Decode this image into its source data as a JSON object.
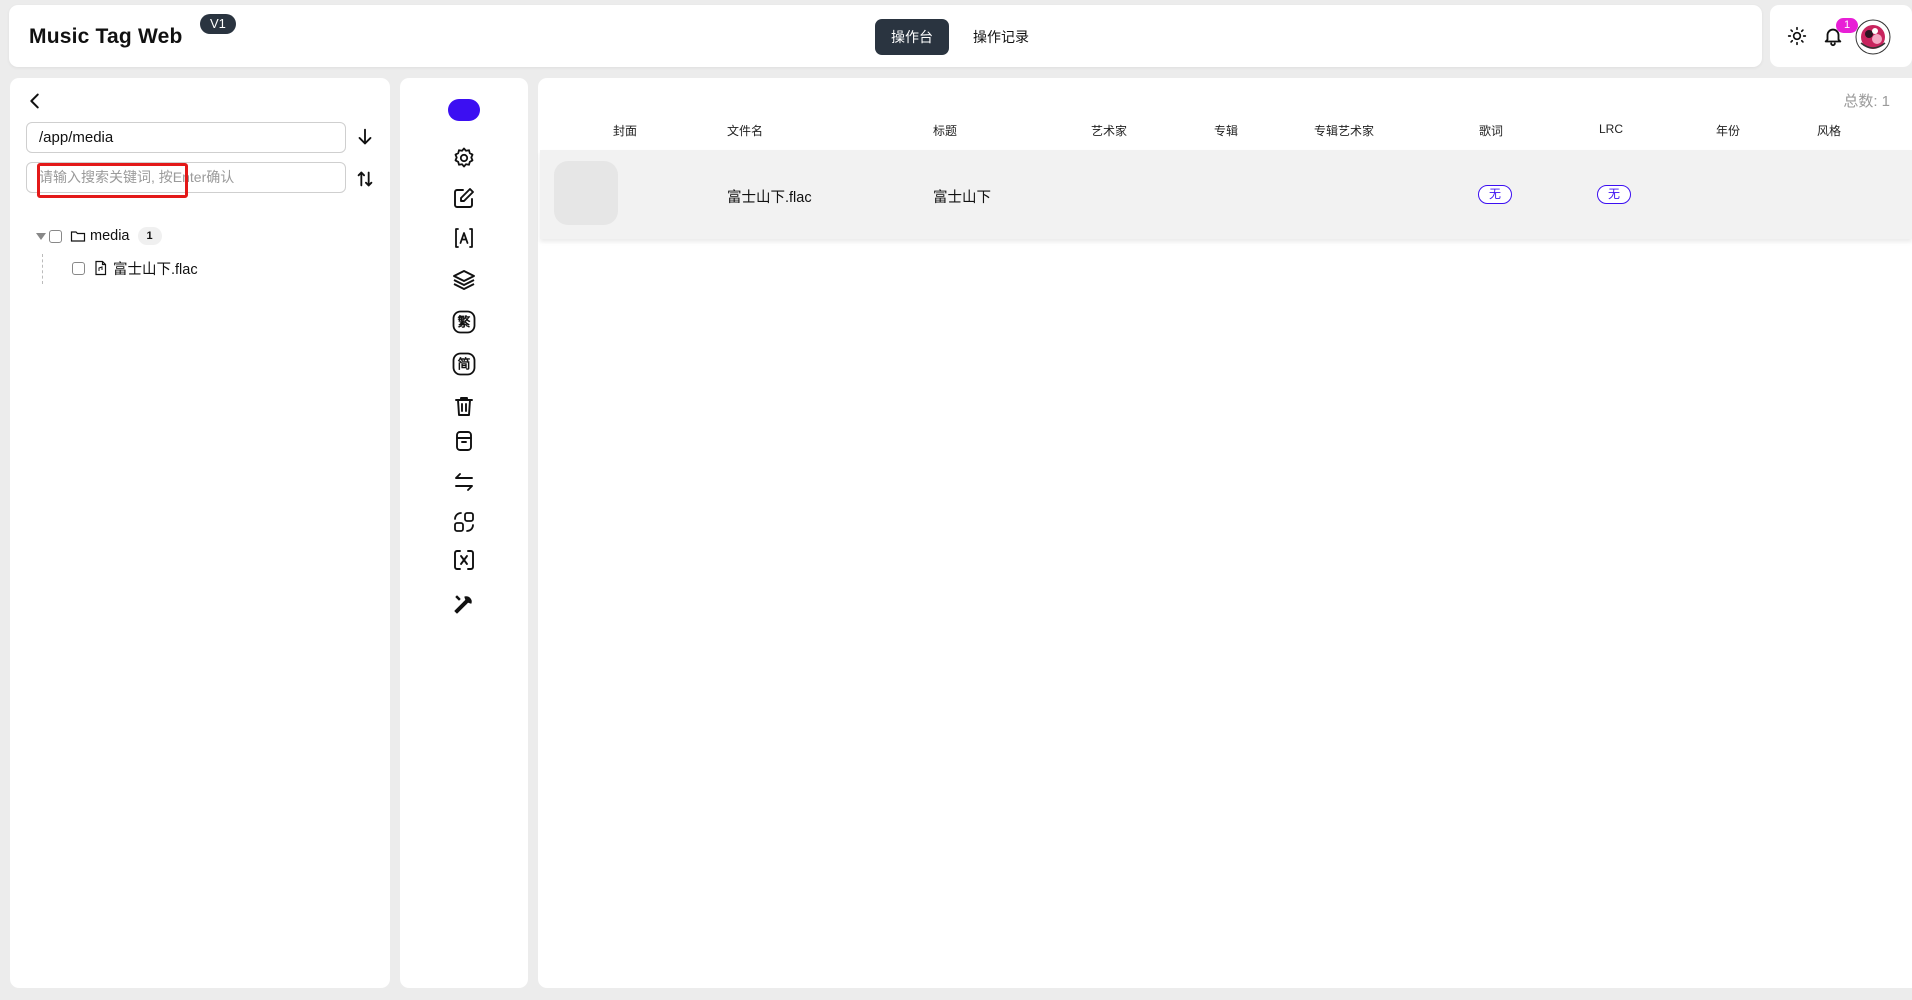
{
  "header": {
    "brand": "Music Tag Web",
    "version": "V1",
    "nav": [
      {
        "label": "操作台",
        "active": true
      },
      {
        "label": "操作记录",
        "active": false
      }
    ],
    "notification_count": "1",
    "accent_color": "#3c0ff2",
    "badge_color": "#e81fd6"
  },
  "sidebar": {
    "path_value": "/app/media",
    "search_placeholder": "请输入搜索关键词, 按Enter确认",
    "tree": {
      "folder_name": "media",
      "folder_count": "1",
      "file_name": "富士山下.flac"
    }
  },
  "toolbar": {
    "icons": [
      "circle-pill",
      "gear-icon",
      "edit-icon",
      "auto-tag-icon",
      "layers-icon",
      "traditional-icon",
      "simplified-icon",
      "trash-icon",
      "archive-icon",
      "swap-icon",
      "convert-icon",
      "unlink-icon",
      "wrench-icon"
    ],
    "traditional_char": "繁",
    "simplified_char": "简"
  },
  "main": {
    "total_label": "总数: 1",
    "columns": [
      "封面",
      "文件名",
      "标题",
      "艺术家",
      "专辑",
      "专辑艺术家",
      "歌词",
      "LRC",
      "年份",
      "风格"
    ],
    "rows": [
      {
        "filename": "富士山下.flac",
        "title": "富士山下",
        "artist": "",
        "album": "",
        "album_artist": "",
        "lyrics": "无",
        "lrc": "无",
        "year": "",
        "genre": ""
      }
    ]
  }
}
